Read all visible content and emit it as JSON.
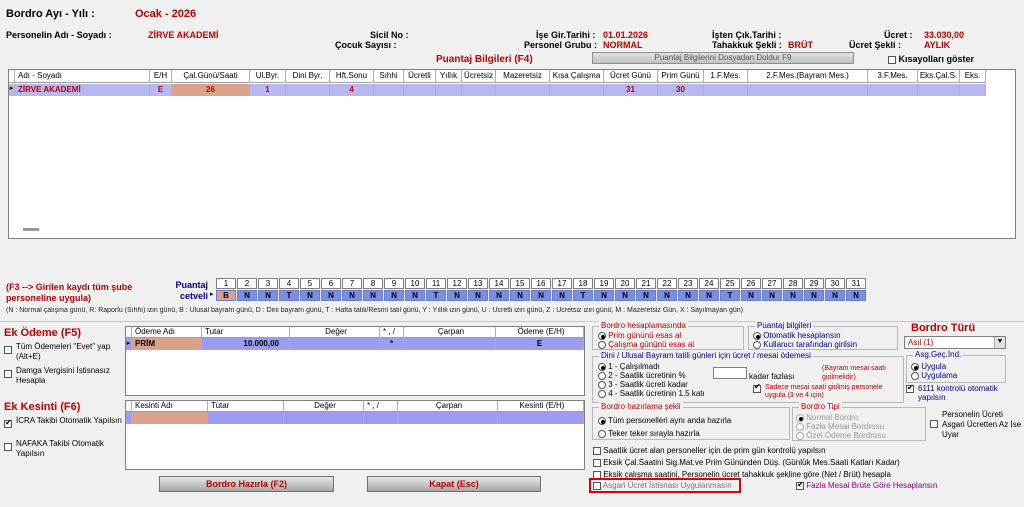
{
  "header": {
    "title_label": "Bordro Ayı - Yılı :",
    "title_value": "Ocak  -  2026",
    "name_label": "Personelin Adı - Soyadı :",
    "name_value": "ZİRVE  AKADEMİ",
    "sicil_label": "Sicil No :",
    "cocuk_label": "Çocuk Sayısı :",
    "ise_gir_label": "İşe Gir.Tarihi :",
    "ise_gir_value": "01.01.2026",
    "grup_label": "Personel Grubu :",
    "grup_value": "NORMAL",
    "isten_cik_label": "İşten Çık.Tarihi :",
    "tahakkuk_label": "Tahakkuk Şekli :",
    "tahakkuk_value": "BRÜT",
    "ucret_label": "Ücret :",
    "ucret_value": "33.030,00",
    "ucret_sekli_label": "Ücret Şekli :",
    "ucret_sekli_value": "AYLIK"
  },
  "puantaj": {
    "title": "Puantaj Bilgileri (F4)",
    "load_button": "Puantaj Bilgilerini Dosyadan Doldur F9",
    "shortcut_label": "Kısayolları göster",
    "columns": [
      "Adı - Soyadı",
      "E/H",
      "Çal.Günü/Saati",
      "Ul.Byr.",
      "Dini Byr.",
      "Hft.Sonu",
      "Sıhhi",
      "Ücretli",
      "Yıllık",
      "Ücretsiz",
      "Mazeretsiz",
      "Kısa Çalışma",
      "Ücret Günü",
      "Prim Günü",
      "1.F.Mes.",
      "2.F.Mes.(Bayram Mes.)",
      "3.F.Mes.",
      "Eks.Çal.S.",
      "Eks."
    ],
    "row": [
      "ZİRVE  AKADEMİ",
      "E",
      "26",
      "1",
      "",
      "4",
      "",
      "",
      "",
      "",
      "",
      "",
      "31",
      "30",
      "",
      "",
      "",
      "",
      ""
    ]
  },
  "cetvel": {
    "hint": "(F3 --> Girilen kaydı tüm şube personeline uygula)",
    "label": "Puantaj cetveli",
    "days": [
      "1",
      "2",
      "3",
      "4",
      "5",
      "6",
      "7",
      "8",
      "9",
      "10",
      "11",
      "12",
      "13",
      "14",
      "15",
      "16",
      "17",
      "18",
      "19",
      "20",
      "21",
      "22",
      "23",
      "24",
      "25",
      "26",
      "27",
      "28",
      "29",
      "30",
      "31"
    ],
    "codes": [
      "B",
      "N",
      "N",
      "T",
      "N",
      "N",
      "N",
      "N",
      "N",
      "N",
      "T",
      "N",
      "N",
      "N",
      "N",
      "N",
      "N",
      "T",
      "N",
      "N",
      "N",
      "N",
      "N",
      "N",
      "T",
      "N",
      "N",
      "N",
      "N",
      "N",
      "N"
    ],
    "legend": "(N : Normal çalışma günü, R: Raporlu (Sıhhi) izin günü, B : Ulusal bayram günü, D : Dini bayram günü, T : Hafta tatili/Resmi tatil günü, Y : Yıllık izin günü, Ü : Ücretli izin günü, Z : Ücretsiz izin günü, M : Mazeretsiz Gün, X : Sayılmayan gün)"
  },
  "ek_odeme": {
    "title": "Ek Ödeme (F5)",
    "cb_tum": "Tüm Ödemeleri \"Evet\" yap (Alt+E)",
    "cb_damga": "Damga Vergisini İstisnasız Hesapla",
    "columns": [
      "Ödeme Adı",
      "Tutar",
      "Değer",
      "* , /",
      "Çarpan",
      "Ödeme (E/H)"
    ],
    "row": [
      "PRİM",
      "10.000,00",
      "",
      "*",
      "",
      "E"
    ]
  },
  "ek_kesinti": {
    "title": "Ek Kesinti (F6)",
    "cb_icra": "İCRA Takibi Otomatik Yapılsın",
    "cb_nafaka": "NAFAKA Takibi Otomatik Yapılsın",
    "columns": [
      "Kesinti Adı",
      "Tutar",
      "Değer",
      "* , /",
      "Çarpan",
      "Kesinti (E/H)"
    ]
  },
  "bordro_hesap": {
    "title": "Bordro hesaplamasında",
    "opt1": "Prim gününü esas al",
    "opt2": "Çalışma gününü esas al"
  },
  "puantaj_bilgileri": {
    "title": "Puantaj bilgileri",
    "opt1": "Otomatik hesaplansın",
    "opt2": "Kullanıcı tarafından girilsin"
  },
  "bordro_turu": {
    "title": "Bordro Türü",
    "value": "Asıl (1)"
  },
  "asg_gec": {
    "title": "Asg.Geç.İnd.",
    "opt1": "Uygula",
    "opt2": "Uygulama",
    "cb": "6111 kontrolü otomatik yapılsın"
  },
  "dini": {
    "title": "Dini / Ulusal Bayram tatili günleri için ücret / mesai ödemesi",
    "opt1": "1 - Çalışılmadı",
    "opt2": "2 - Saatlik ücretinin %",
    "opt3": "3 - Saatlik ücreti kadar",
    "opt4": "4 - Saatlik ücretinin 1.5 katı",
    "kadar": "kadar fazlası",
    "note": "(Bayram mesai saati girilmelidir)",
    "cb": "Sadece mesai saati girilmiş personele uygula (3 ve 4 için)"
  },
  "hazirlama": {
    "title": "Bordro hazırlama şekli",
    "opt1": "Tüm personelleri aynı anda hazırla",
    "opt2": "Teker teker sırayla hazırla"
  },
  "bordro_tipi": {
    "title": "Bordro Tipi",
    "opt1": "Normal Bordro",
    "opt2": "Fazla Mesai Bordrosu",
    "opt3": "Özel Ödeme Bordrosu"
  },
  "personelin_ucreti": "Personelin Ücreti Asgari Ücretten Az İse Uyar",
  "bottom_checks": {
    "c1": "Saatlik ücret alan personeller için de prim gün kontrolü yapılsın",
    "c2": "Eksik Çal.Saatini Sig.Mat.ve Prim Gününden Düş. (Günlük Mes.Saati Katları Kadar)",
    "c3": "Eksik çalışma saatini, Personelin ücret tahakkuk şekline göre (Net / Brüt) hesapla",
    "c4": "Asgari Ücret İstisnası Uygulanmasın",
    "c5": "Fazla Mesai Brüte Göre Hesaplansın"
  },
  "buttons": {
    "hazirla": "Bordro Hazırla (F2)",
    "kapat": "Kapat (Esc)"
  }
}
